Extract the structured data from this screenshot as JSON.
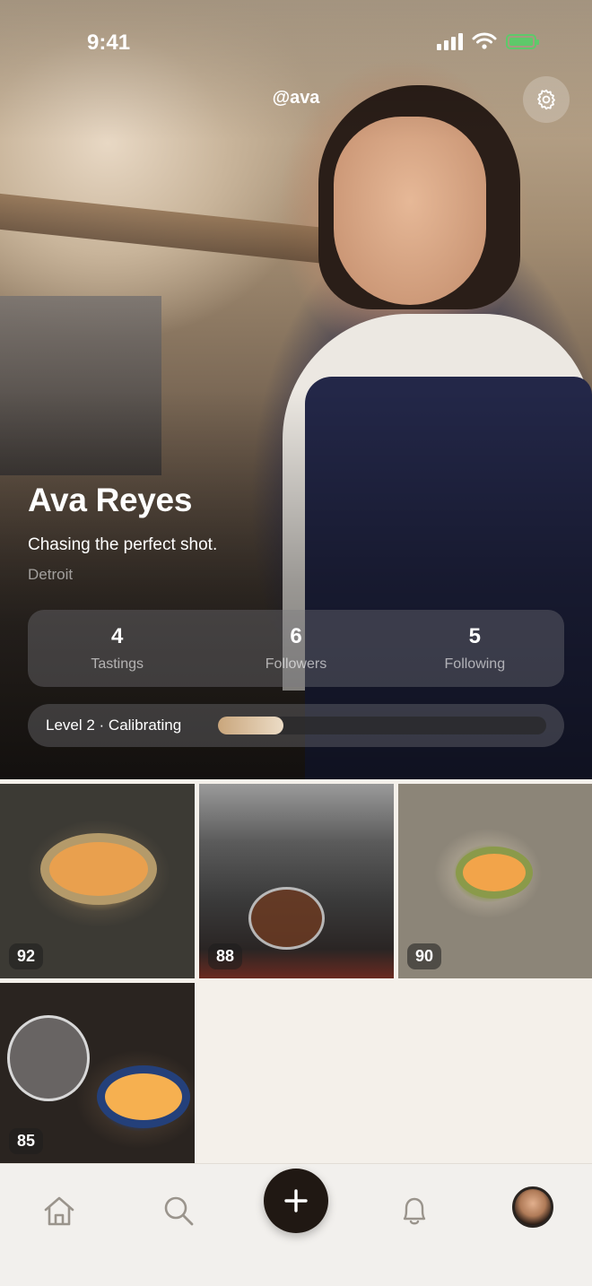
{
  "status_bar": {
    "time": "9:41"
  },
  "profile": {
    "handle": "@ava",
    "name": "Ava Reyes",
    "bio": "Chasing the perfect shot.",
    "location": "Detroit"
  },
  "stats": [
    {
      "value": "4",
      "label": "Tastings"
    },
    {
      "value": "6",
      "label": "Followers"
    },
    {
      "value": "5",
      "label": "Following"
    }
  ],
  "level": {
    "label": "Level 2 · Calibrating",
    "progress": 0.2
  },
  "tastings": [
    {
      "score": "92"
    },
    {
      "score": "88"
    },
    {
      "score": "90"
    },
    {
      "score": "85"
    }
  ],
  "icons": {
    "settings": "gear-icon",
    "home": "home-icon",
    "search": "search-icon",
    "add": "plus-icon",
    "notifications": "bell-icon",
    "profile": "avatar"
  },
  "colors": {
    "background": "#f4f0ea",
    "fab": "#201813",
    "battery": "#5ec96a",
    "progress_start": "#c9a67c",
    "progress_end": "#ecdcc6"
  }
}
